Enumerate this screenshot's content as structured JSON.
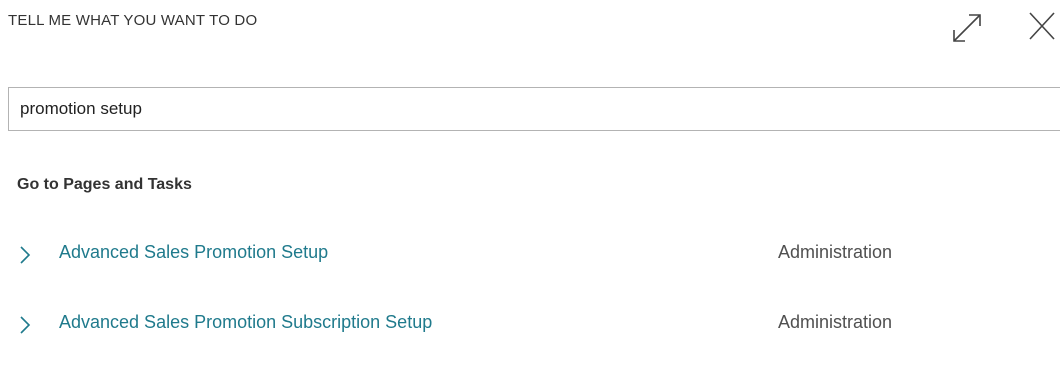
{
  "dialog": {
    "title": "TELL ME WHAT YOU WANT TO DO",
    "icons": {
      "expand": "expand-icon",
      "close": "close-icon"
    }
  },
  "search": {
    "value": "promotion setup",
    "placeholder": ""
  },
  "section": {
    "heading": "Go to Pages and Tasks"
  },
  "results": [
    {
      "label": "Advanced Sales Promotion Setup",
      "category": "Administration",
      "icon": "chevron-right-icon"
    },
    {
      "label": "Advanced Sales Promotion Subscription Setup",
      "category": "Administration",
      "icon": "chevron-right-icon"
    }
  ],
  "colors": {
    "link": "#1f7a8c",
    "text": "#212121",
    "muted": "#505050",
    "border": "#b3b3b3"
  }
}
